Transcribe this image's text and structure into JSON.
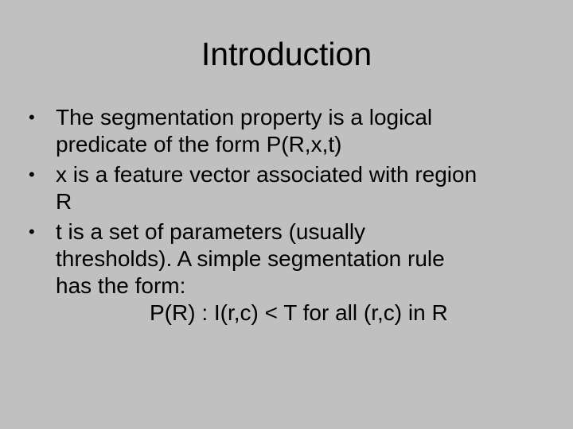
{
  "slide": {
    "title": "Introduction",
    "bullet_glyph": "•",
    "bullets": [
      {
        "lines": [
          "The segmentation property is a logical",
          "predicate of the form P(R,x,t)"
        ]
      },
      {
        "lines": [
          "x is a feature vector associated with region",
          "R"
        ]
      },
      {
        "lines": [
          "t is a set of parameters (usually",
          "thresholds). A simple segmentation rule",
          "has the form:"
        ],
        "formula": "P(R) : I(r,c) < T for all (r,c) in R"
      }
    ]
  },
  "colors": {
    "background": "#c0c0c0",
    "text": "#000000"
  }
}
